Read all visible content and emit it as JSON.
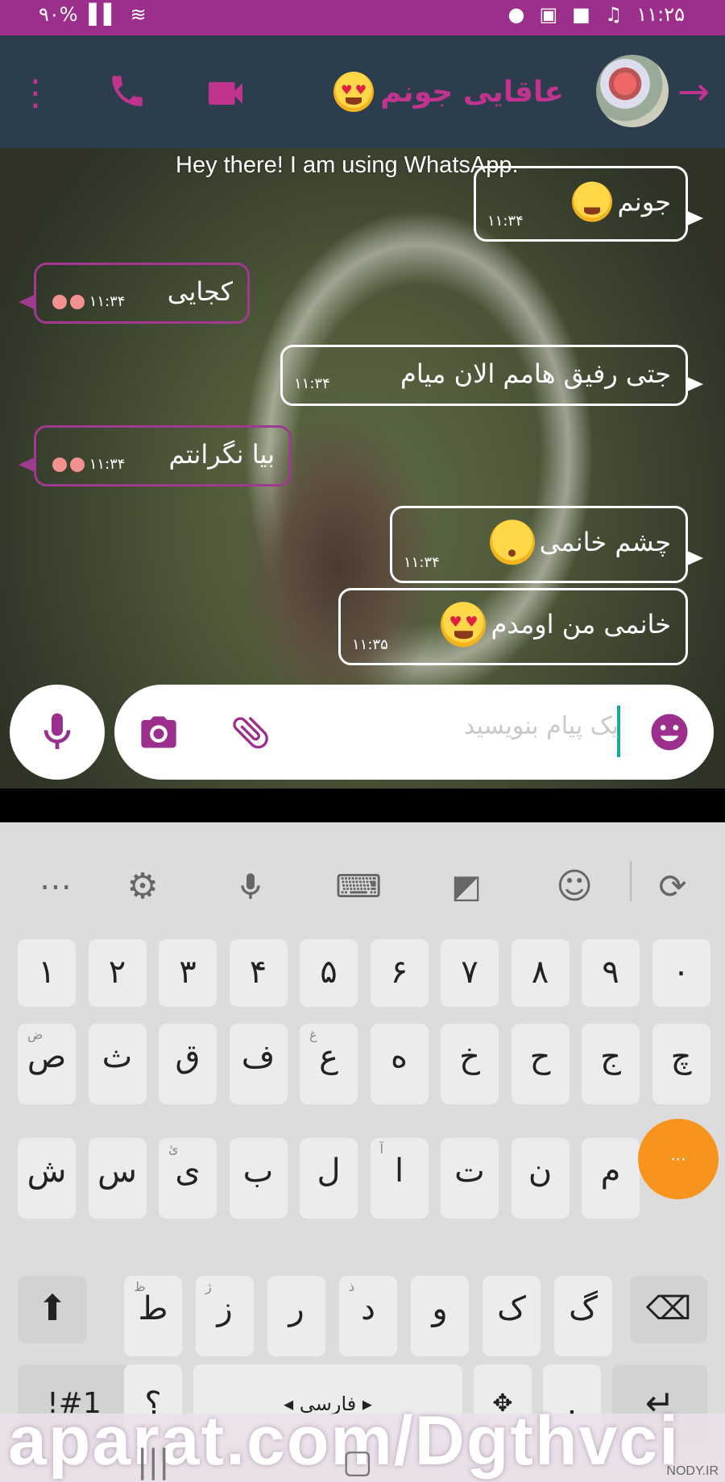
{
  "status_bar": {
    "battery": "۹۰%",
    "time": "۱۱:۲۵"
  },
  "header": {
    "contact_name": "عاقایی جونم"
  },
  "chat": {
    "status_text": "Hey there! I am using WhatsApp.",
    "messages": [
      {
        "direction": "out",
        "text": "جونم",
        "time": "۱۱:۳۴"
      },
      {
        "direction": "in",
        "text": "کجایی",
        "time": "۱۱:۳۴"
      },
      {
        "direction": "out",
        "text": "جتی رفیق هامم الان میام",
        "time": "۱۱:۳۴"
      },
      {
        "direction": "in",
        "text": "بیا نگرانتم",
        "time": "۱۱:۳۴"
      },
      {
        "direction": "out",
        "text": "چشم خانمی",
        "time": "۱۱:۳۴"
      },
      {
        "direction": "out",
        "text": "خانمی من اومدم",
        "time": "۱۱:۳۵"
      }
    ]
  },
  "composer": {
    "placeholder": "یک پیام بنویسید"
  },
  "keyboard": {
    "row_digits": [
      "۱",
      "۲",
      "۳",
      "۴",
      "۵",
      "۶",
      "۷",
      "۸",
      "۹",
      "۰"
    ],
    "row1": [
      {
        "main": "ص",
        "hint": "ض"
      },
      {
        "main": "ث",
        "hint": ""
      },
      {
        "main": "ق",
        "hint": ""
      },
      {
        "main": "ف",
        "hint": ""
      },
      {
        "main": "ع",
        "hint": "غ"
      },
      {
        "main": "ه",
        "hint": ""
      },
      {
        "main": "خ",
        "hint": ""
      },
      {
        "main": "ح",
        "hint": ""
      },
      {
        "main": "ج",
        "hint": ""
      },
      {
        "main": "چ",
        "hint": ""
      }
    ],
    "row2": [
      {
        "main": "ش",
        "hint": ""
      },
      {
        "main": "س",
        "hint": ""
      },
      {
        "main": "ی",
        "hint": "ئ"
      },
      {
        "main": "ب",
        "hint": ""
      },
      {
        "main": "ل",
        "hint": ""
      },
      {
        "main": "ا",
        "hint": "آ"
      },
      {
        "main": "ت",
        "hint": ""
      },
      {
        "main": "ن",
        "hint": ""
      },
      {
        "main": "م",
        "hint": ""
      }
    ],
    "row3": [
      {
        "main": "ط",
        "hint": "ظ"
      },
      {
        "main": "ز",
        "hint": "ژ"
      },
      {
        "main": "ر",
        "hint": ""
      },
      {
        "main": "د",
        "hint": "ذ"
      },
      {
        "main": "و",
        "hint": ""
      },
      {
        "main": "ک",
        "hint": ""
      },
      {
        "main": "گ",
        "hint": ""
      }
    ],
    "symbols_label": "!#1",
    "question_label": "؟",
    "language_label": "فارسی",
    "period_label": ".",
    "orange_label": "⋅⋅⋅"
  },
  "watermark": {
    "text": "aparat.com/Dgthvci",
    "corner": "NODY.IR"
  }
}
